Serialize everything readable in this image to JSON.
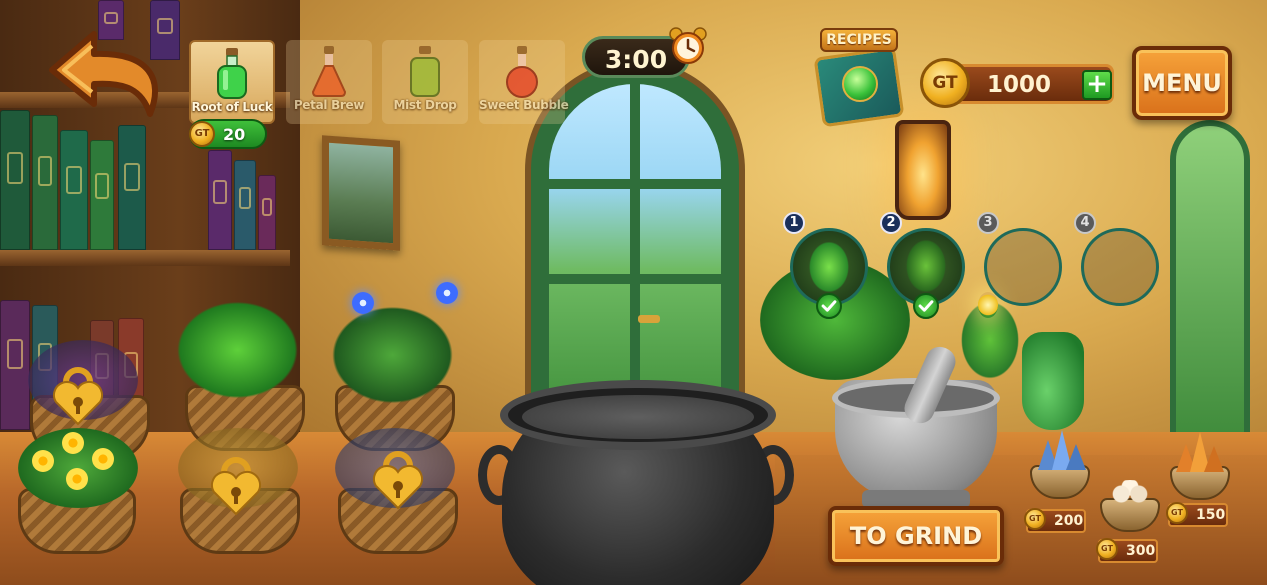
{
  "navigation": {
    "back_icon": "back-arrow-icon"
  },
  "recipe_tabs": [
    {
      "label": "Root of Luck",
      "potion_color": "#3fd24a",
      "selected": true
    },
    {
      "label": "Petal Brew",
      "potion_color": "#f0602a",
      "selected": false
    },
    {
      "label": "Mist Drop",
      "potion_color": "#9ac23a",
      "selected": false
    },
    {
      "label": "Sweet Bubble",
      "potion_color": "#e8402a",
      "selected": false
    }
  ],
  "selected_recipe_cost": {
    "currency_symbol": "GT",
    "value": "20"
  },
  "timer": {
    "value": "3:00",
    "icon": "alarm-clock-icon"
  },
  "recipes_button": {
    "label": "RECIPES",
    "icon": "recipe-book-icon"
  },
  "currency": {
    "symbol": "GT",
    "balance": "1000",
    "add_label": "+"
  },
  "menu_button": {
    "label": "MENU"
  },
  "ingredient_slots": [
    {
      "number": "1",
      "filled": true,
      "item": "herb-sprig-icon",
      "checked": true
    },
    {
      "number": "2",
      "filled": true,
      "item": "herb-sprig-icon",
      "checked": true
    },
    {
      "number": "3",
      "filled": false
    },
    {
      "number": "4",
      "filled": false
    }
  ],
  "grind_button": {
    "label": "TO GRIND"
  },
  "shop_items": [
    {
      "item": "blue-crystal-icon",
      "price": "200",
      "currency_symbol": "GT"
    },
    {
      "item": "pearls-icon",
      "price": "300",
      "currency_symbol": "GT"
    },
    {
      "item": "amber-crystal-icon",
      "price": "150",
      "currency_symbol": "GT"
    }
  ],
  "plant_pots": [
    {
      "plant": "purple-flowers",
      "locked": true
    },
    {
      "plant": "mint",
      "locked": false
    },
    {
      "plant": "blue-flower-bush",
      "locked": false
    },
    {
      "plant": "yellow-flowers",
      "locked": false
    },
    {
      "plant": "yellow-flowers",
      "locked": true
    },
    {
      "plant": "blue-flowers",
      "locked": true
    }
  ],
  "colors": {
    "accent_orange": "#f6a33a",
    "button_border": "#6a2c08",
    "badge_green": "#1e8a22",
    "slot_ring": "#1e6a5a"
  }
}
